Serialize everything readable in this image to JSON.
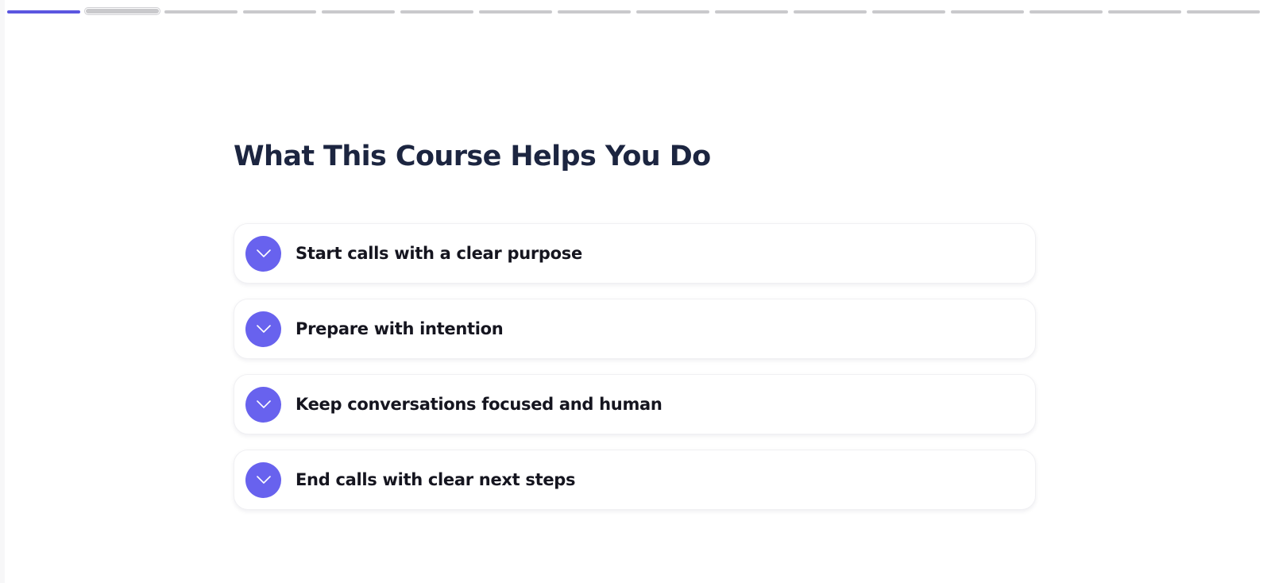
{
  "progress": {
    "total_steps": 16,
    "completed_steps": 1,
    "current_step": 2,
    "colors": {
      "completed": "#5b56e0",
      "pending": "#c9c9cc"
    }
  },
  "section": {
    "title": "What This Course Helps You Do"
  },
  "accordion": {
    "icon": "chevron-down-icon",
    "accent_color": "#6862ee",
    "items": [
      {
        "label": "Start calls with a clear purpose"
      },
      {
        "label": "Prepare with intention"
      },
      {
        "label": "Keep conversations focused and human"
      },
      {
        "label": "End calls with clear next steps"
      }
    ]
  }
}
